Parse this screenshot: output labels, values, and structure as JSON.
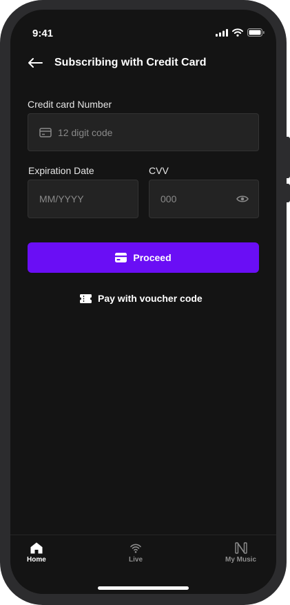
{
  "status_bar": {
    "time": "9:41"
  },
  "header": {
    "title": "Subscribing with Credit Card"
  },
  "form": {
    "card_number": {
      "label": "Credit card Number",
      "placeholder": "12 digit code",
      "value": ""
    },
    "expiration": {
      "label": "Expiration Date",
      "placeholder": "MM/YYYY",
      "value": ""
    },
    "cvv": {
      "label": "CVV",
      "placeholder": "000",
      "value": ""
    }
  },
  "actions": {
    "proceed_label": "Proceed",
    "voucher_label": "Pay with voucher code"
  },
  "tab_bar": {
    "items": [
      {
        "label": "Home",
        "icon": "home-icon",
        "active": true
      },
      {
        "label": "Live",
        "icon": "live-icon",
        "active": false
      },
      {
        "label": "My Music",
        "icon": "my-music-icon",
        "active": false
      }
    ]
  },
  "colors": {
    "accent": "#6a0ef5",
    "background": "#141414",
    "field": "#232323",
    "inactive_tab": "#8e8e8e"
  }
}
